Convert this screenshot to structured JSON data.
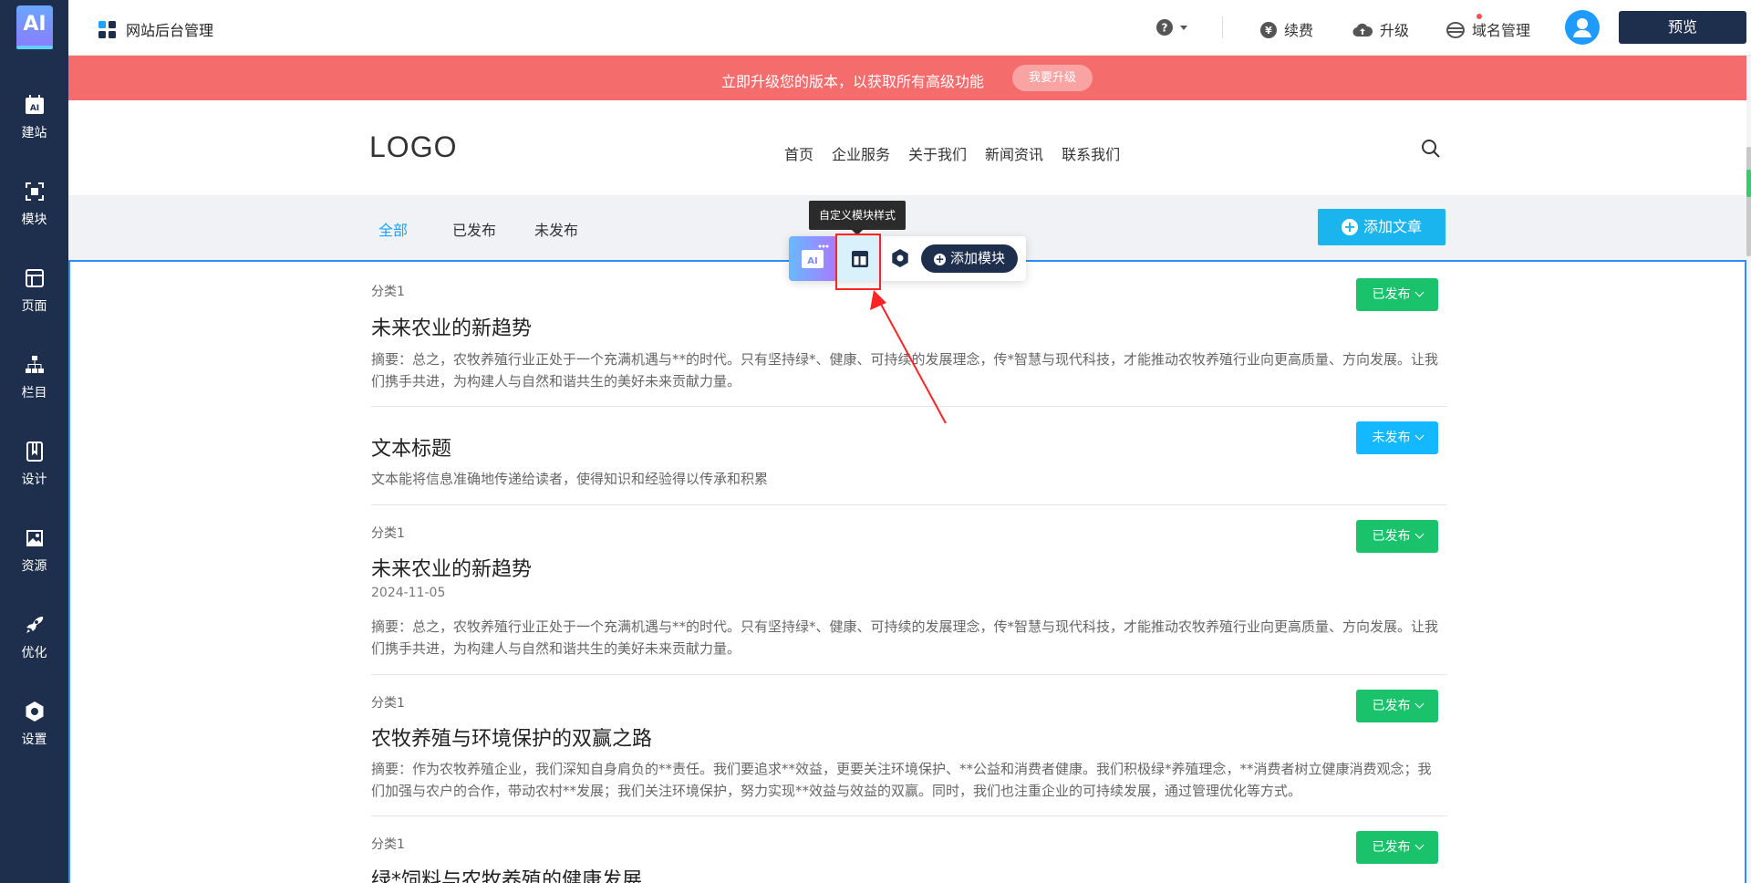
{
  "sidebar": {
    "logo": "AI",
    "items": [
      {
        "label": "建站",
        "icon": "ai-calendar-icon"
      },
      {
        "label": "模块",
        "icon": "module-frame-icon"
      },
      {
        "label": "页面",
        "icon": "page-layout-icon"
      },
      {
        "label": "栏目",
        "icon": "sitemap-icon"
      },
      {
        "label": "设计",
        "icon": "design-book-icon"
      },
      {
        "label": "资源",
        "icon": "image-resource-icon"
      },
      {
        "label": "优化",
        "icon": "rocket-icon"
      },
      {
        "label": "设置",
        "icon": "gear-icon"
      }
    ]
  },
  "topbar": {
    "brand": "网站后台管理",
    "help_icon": "question-icon",
    "renew": "续费",
    "upgrade": "升级",
    "domain": "域名管理",
    "preview": "预览"
  },
  "banner": {
    "text": "立即升级您的版本，以获取所有高级功能",
    "button": "我要升级"
  },
  "site": {
    "logo": "LOGO",
    "nav": [
      "首页",
      "企业服务",
      "关于我们",
      "新闻资讯",
      "联系我们"
    ]
  },
  "tabs": {
    "all": "全部",
    "published": "已发布",
    "unpublished": "未发布",
    "add_article": "添加文章"
  },
  "toolbar": {
    "tooltip": "自定义模块样式",
    "add_module": "添加模块"
  },
  "articles": [
    {
      "category": "分类1",
      "title": "未来农业的新趋势",
      "date": "",
      "summary": "摘要：总之，农牧养殖行业正处于一个充满机遇与**的时代。只有坚持绿*、健康、可持续的发展理念，传*智慧与现代科技，才能推动农牧养殖行业向更高质量、方向发展。让我们携手共进，为构建人与自然和谐共生的美好未来贡献力量。",
      "status": "已发布"
    },
    {
      "category": "",
      "title": "文本标题",
      "date": "",
      "summary": "文本能将信息准确地传递给读者，使得知识和经验得以传承和积累",
      "status": "未发布"
    },
    {
      "category": "分类1",
      "title": "未来农业的新趋势",
      "date": "2024-11-05",
      "summary": "摘要：总之，农牧养殖行业正处于一个充满机遇与**的时代。只有坚持绿*、健康、可持续的发展理念，传*智慧与现代科技，才能推动农牧养殖行业向更高质量、方向发展。让我们携手共进，为构建人与自然和谐共生的美好未来贡献力量。",
      "status": "已发布"
    },
    {
      "category": "分类1",
      "title": "农牧养殖与环境保护的双赢之路",
      "date": "",
      "summary": "摘要：作为农牧养殖企业，我们深知自身肩负的**责任。我们要追求**效益，更要关注环境保护、**公益和消费者健康。我们积极绿*养殖理念，**消费者树立健康消费观念；我们加强与农户的合作，带动农村**发展；我们关注环境保护，努力实现**效益与效益的双赢。同时，我们也注重企业的可持续发展，通过管理优化等方式。",
      "status": "已发布"
    },
    {
      "category": "分类1",
      "title": "绿*饲料与农牧养殖的健康发展",
      "date": "",
      "summary": "",
      "status": "已发布"
    }
  ],
  "colors": {
    "sidebar": "#1e2f4d",
    "banner": "#f56c6c",
    "published": "#19c26b",
    "unpublished": "#14b8ff",
    "accent": "#1aa3ff"
  }
}
